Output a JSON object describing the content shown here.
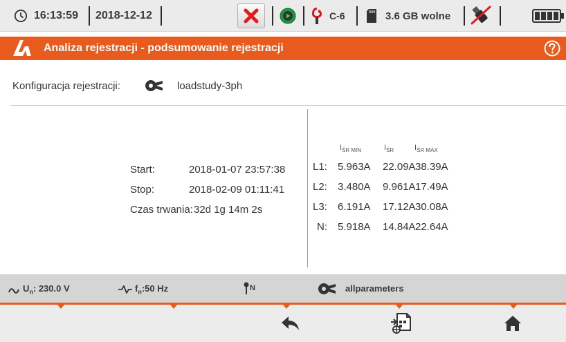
{
  "status": {
    "time": "16:13:59",
    "date": "2018-12-12",
    "clamp_type": "C-6",
    "storage": "3.6 GB wolne"
  },
  "title": "Analiza rejestracji - podsumowanie rejestracji",
  "config": {
    "label": "Konfiguracja rejestracji:",
    "name": "loadstudy-3ph"
  },
  "summary": {
    "start_label": "Start:",
    "start_value": "2018-01-07 23:57:38",
    "stop_label": "Stop:",
    "stop_value": "2018-02-09 01:11:41",
    "duration_label": "Czas trwania:",
    "duration_value": "32d 1g 14m 2s"
  },
  "measurements": {
    "headers": [
      {
        "main": "I",
        "sub": "ŚR MIN"
      },
      {
        "main": "I",
        "sub": "ŚR"
      },
      {
        "main": "I",
        "sub": "ŚR MAX"
      }
    ],
    "rows": [
      {
        "phase": "L1:",
        "min": "5.963A",
        "avg": "22.09A",
        "max": "38.39A"
      },
      {
        "phase": "L2:",
        "min": "3.480A",
        "avg": "9.961A",
        "max": "17.49A"
      },
      {
        "phase": "L3:",
        "min": "6.191A",
        "avg": "17.12A",
        "max": "30.08A"
      },
      {
        "phase": "N:",
        "min": "5.918A",
        "avg": "14.84A",
        "max": "22.64A"
      }
    ]
  },
  "info": {
    "voltage_prefix": "U",
    "voltage_sub": "n",
    "voltage_value": ": 230.0 V",
    "freq_prefix": "f",
    "freq_sub": "n",
    "freq_value": ":50 Hz",
    "neutral_label": "N",
    "profile": "allparameters"
  },
  "colors": {
    "accent": "#e95b1c",
    "statusbar": "#ebebeb",
    "infostrip": "#d5d5d5",
    "navbar": "#ececec"
  }
}
